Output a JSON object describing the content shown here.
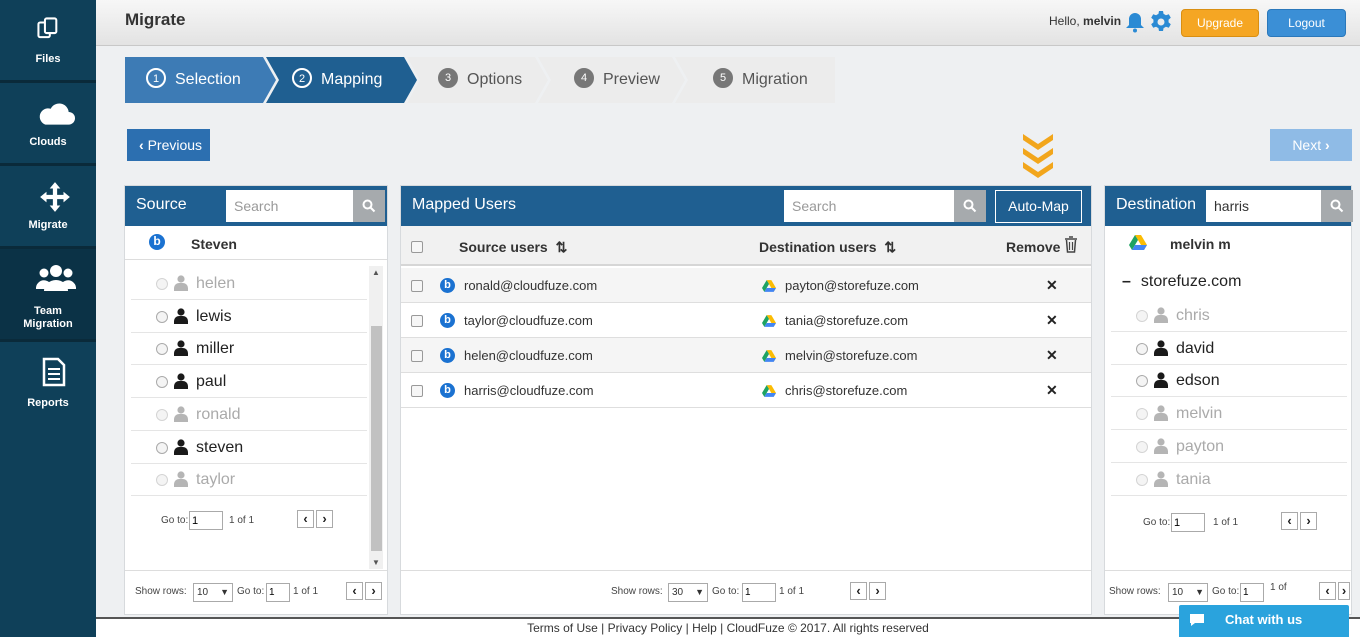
{
  "sidebar": {
    "items": [
      {
        "label": "Files",
        "icon": "files-icon"
      },
      {
        "label": "Clouds",
        "icon": "cloud-icon"
      },
      {
        "label": "Migrate",
        "icon": "move-arrows-icon"
      },
      {
        "label": "Team Migration",
        "icon": "team-icon"
      },
      {
        "label": "Reports",
        "icon": "report-icon"
      }
    ],
    "active": "Team Migration"
  },
  "header": {
    "title": "Migrate",
    "greeting": "Hello,",
    "username": "melvin",
    "upgrade_label": "Upgrade",
    "logout_label": "Logout"
  },
  "steps": [
    {
      "num": "1",
      "label": "Selection",
      "state": "done"
    },
    {
      "num": "2",
      "label": "Mapping",
      "state": "current"
    },
    {
      "num": "3",
      "label": "Options",
      "state": "todo"
    },
    {
      "num": "4",
      "label": "Preview",
      "state": "todo"
    },
    {
      "num": "5",
      "label": "Migration",
      "state": "todo"
    }
  ],
  "nav": {
    "previous_label": "Previous",
    "next_label": "Next"
  },
  "source": {
    "title": "Source",
    "search_placeholder": "Search",
    "search_value": "",
    "account": "Steven",
    "users": [
      {
        "name": "helen",
        "enabled": false
      },
      {
        "name": "lewis",
        "enabled": true
      },
      {
        "name": "miller",
        "enabled": true
      },
      {
        "name": "paul",
        "enabled": true
      },
      {
        "name": "ronald",
        "enabled": false
      },
      {
        "name": "steven",
        "enabled": true
      },
      {
        "name": "taylor",
        "enabled": false
      }
    ],
    "pager": {
      "goto_label": "Go to:",
      "page": "1",
      "of": "1 of 1"
    },
    "footer": {
      "show_rows_label": "Show rows:",
      "rows": "10",
      "goto_label": "Go to:",
      "page": "1",
      "of": "1 of 1"
    }
  },
  "mapped": {
    "title": "Mapped Users",
    "search_placeholder": "Search",
    "automap_label": "Auto-Map",
    "col_source": "Source users",
    "col_destination": "Destination users",
    "col_remove": "Remove",
    "rows": [
      {
        "source": "ronald@cloudfuze.com",
        "destination": "payton@storefuze.com"
      },
      {
        "source": "taylor@cloudfuze.com",
        "destination": "tania@storefuze.com"
      },
      {
        "source": "helen@cloudfuze.com",
        "destination": "melvin@storefuze.com"
      },
      {
        "source": "harris@cloudfuze.com",
        "destination": "chris@storefuze.com"
      }
    ],
    "footer": {
      "show_rows_label": "Show rows:",
      "rows": "30",
      "goto_label": "Go to:",
      "page": "1",
      "of": "1 of 1"
    }
  },
  "destination": {
    "title": "Destination",
    "search_value": "harris",
    "account": "melvin m",
    "domain": "storefuze.com",
    "users": [
      {
        "name": "chris",
        "enabled": false
      },
      {
        "name": "david",
        "enabled": true
      },
      {
        "name": "edson",
        "enabled": true
      },
      {
        "name": "melvin",
        "enabled": false
      },
      {
        "name": "payton",
        "enabled": false
      },
      {
        "name": "tania",
        "enabled": false
      }
    ],
    "pager": {
      "goto_label": "Go to:",
      "page": "1",
      "of": "1 of 1"
    },
    "footer": {
      "show_rows_label": "Show rows:",
      "rows": "10",
      "goto_label": "Go to:",
      "page": "1",
      "of": "1 of"
    }
  },
  "footer": {
    "terms": "Terms of Use",
    "privacy": "Privacy Policy",
    "help": "Help",
    "copyright": "CloudFuze © 2017. All rights reserved"
  },
  "chat": {
    "label": "Chat with us"
  },
  "colors": {
    "sidebar": "#0f4059",
    "panel_header": "#1f5f91",
    "step_active": "#2a6496",
    "upgrade": "#f5a623",
    "logout": "#3b8fd6",
    "chevron_accent": "#f2a61c",
    "chat": "#2aa3dd"
  }
}
